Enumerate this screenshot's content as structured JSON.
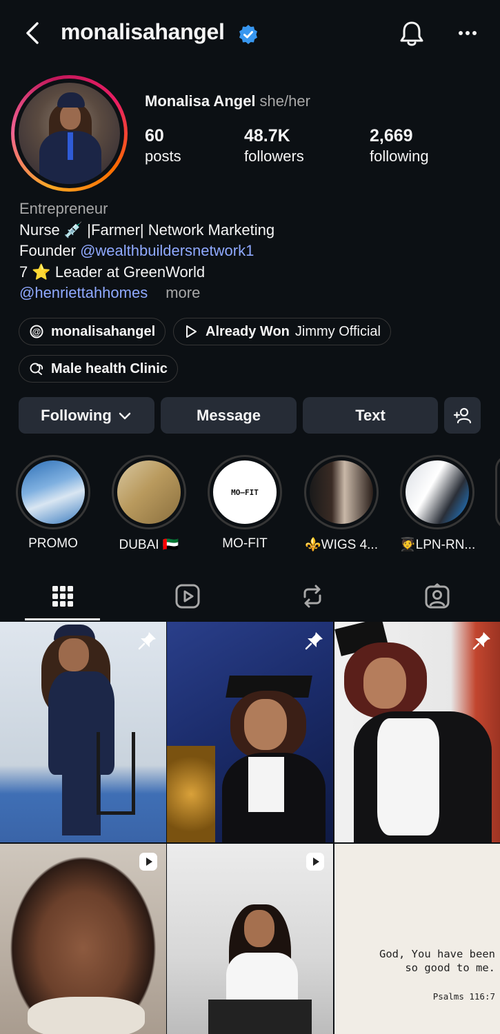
{
  "header": {
    "username": "monalisahangel",
    "icons": [
      "back-arrow-icon",
      "verified-badge-icon",
      "bell-icon",
      "more-options-icon"
    ]
  },
  "profile": {
    "display_name": "Monalisa Angel",
    "pronouns": "she/her",
    "stats": {
      "posts_count": "60",
      "posts_label": "posts",
      "followers_count": "48.7K",
      "followers_label": "followers",
      "following_count": "2,669",
      "following_label": "following"
    }
  },
  "bio": {
    "category": "Entrepreneur",
    "line1": "Nurse 💉 |Farmer| Network Marketing",
    "line2_prefix": "Founder ",
    "line2_link": "@wealthbuildersnetwork1",
    "line3": "7 ⭐ Leader at GreenWorld",
    "line4_link": "@henriettahhomes",
    "more": "more"
  },
  "chips": {
    "threads": "monalisahangel",
    "music_title": "Already Won",
    "music_artist": "Jimmy Official",
    "channel": "Male health Clinic"
  },
  "actions": {
    "following": "Following",
    "message": "Message",
    "text": "Text"
  },
  "highlights": [
    {
      "label": "PROMO"
    },
    {
      "label": "DUBAI 🇦🇪"
    },
    {
      "label": "MO-FIT",
      "logo_text": "MO—FIT"
    },
    {
      "label": "⚜️WIGS 4..."
    },
    {
      "label": "🧑‍🎓LPN-RN..."
    }
  ],
  "tabs": [
    "grid-tab",
    "reels-tab",
    "reposts-tab",
    "tagged-tab"
  ],
  "posts": {
    "quote_text_line1": "God, You have been",
    "quote_text_line2": "so good to me.",
    "quote_ref": "Psalms 116:7"
  },
  "colors": {
    "background": "#0c1014",
    "button_bg": "#262c36",
    "link": "#8fa9ff",
    "verified": "#3897f0"
  }
}
